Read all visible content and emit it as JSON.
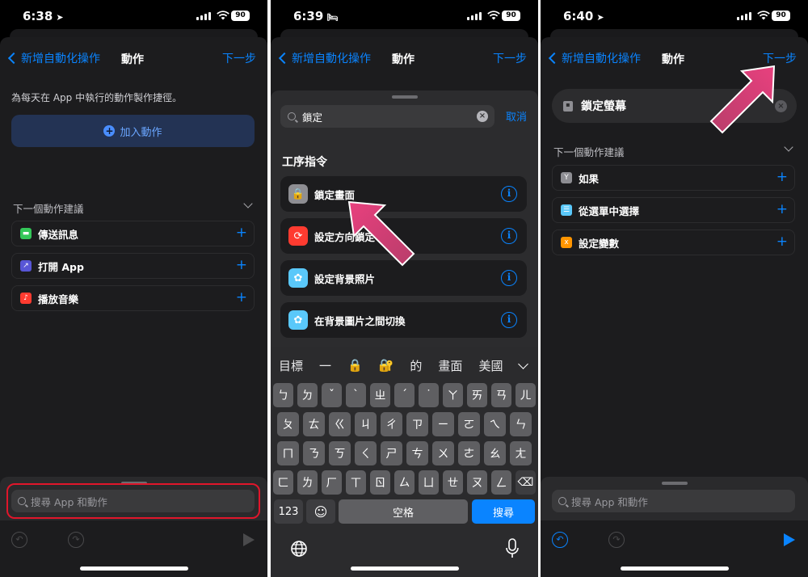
{
  "phone1": {
    "time": "6:38",
    "battery": "90",
    "nav": {
      "back_label": "新增自動化操作",
      "title": "動作",
      "next_label": "下一步"
    },
    "description": "為每天在 App 中執行的動作製作捷徑。",
    "add_action_label": "加入動作",
    "suggestions_header": "下一個動作建議",
    "suggestions": [
      {
        "label": "傳送訊息",
        "icon": "message-icon",
        "color": "#34c759"
      },
      {
        "label": "打開 App",
        "icon": "app-icon",
        "color": "#5856d6"
      },
      {
        "label": "播放音樂",
        "icon": "music-icon",
        "color": "#ff3b30"
      }
    ],
    "search_placeholder": "搜尋 App 和動作"
  },
  "phone2": {
    "time": "6:39",
    "battery": "90",
    "nav": {
      "back_label": "新增自動化操作",
      "title": "動作",
      "next_label": "下一步"
    },
    "search_value": "鎖定",
    "cancel_label": "取消",
    "section_title": "工序指令",
    "results": [
      {
        "label": "鎖定畫面",
        "icon": "lock-icon",
        "color": "#8e8e93"
      },
      {
        "label": "設定方向鎖定",
        "icon": "orientation-lock-icon",
        "color": "#ff3b30"
      },
      {
        "label": "設定背景照片",
        "icon": "wallpaper-icon",
        "color": "#5ac8fa"
      },
      {
        "label": "在背景圖片之間切換",
        "icon": "wallpaper-icon",
        "color": "#5ac8fa"
      }
    ],
    "keyboard": {
      "candidates": [
        "目標",
        "一",
        "🔒",
        "🔐",
        "的",
        "畫面",
        "美國"
      ],
      "row1": [
        "ㄅ",
        "ㄉ",
        "ˇ",
        "ˋ",
        "ㄓ",
        "ˊ",
        "˙",
        "ㄚ",
        "ㄞ",
        "ㄢ",
        "ㄦ"
      ],
      "row2": [
        "ㄆ",
        "ㄊ",
        "ㄍ",
        "ㄐ",
        "ㄔ",
        "ㄗ",
        "ㄧ",
        "ㄛ",
        "ㄟ",
        "ㄣ"
      ],
      "row3": [
        "ㄇ",
        "ㄋ",
        "ㄎ",
        "ㄑ",
        "ㄕ",
        "ㄘ",
        "ㄨ",
        "ㄜ",
        "ㄠ",
        "ㄤ"
      ],
      "row4": [
        "ㄈ",
        "ㄌ",
        "ㄏ",
        "ㄒ",
        "ㄖ",
        "ㄙ",
        "ㄩ",
        "ㄝ",
        "ㄡ",
        "ㄥ"
      ],
      "num_label": "123",
      "space_label": "空格",
      "search_label": "搜尋"
    }
  },
  "phone3": {
    "time": "6:40",
    "battery": "90",
    "nav": {
      "back_label": "新增自動化操作",
      "title": "動作",
      "next_label": "下一步"
    },
    "action_label": "鎖定螢幕",
    "suggestions_header": "下一個動作建議",
    "suggestions": [
      {
        "label": "如果",
        "icon": "branch-icon",
        "color": "#8e8e93"
      },
      {
        "label": "從選單中選擇",
        "icon": "menu-icon",
        "color": "#5ac8fa"
      },
      {
        "label": "設定變數",
        "icon": "variable-icon",
        "color": "#ff9500"
      }
    ],
    "search_placeholder": "搜尋 App 和動作"
  }
}
